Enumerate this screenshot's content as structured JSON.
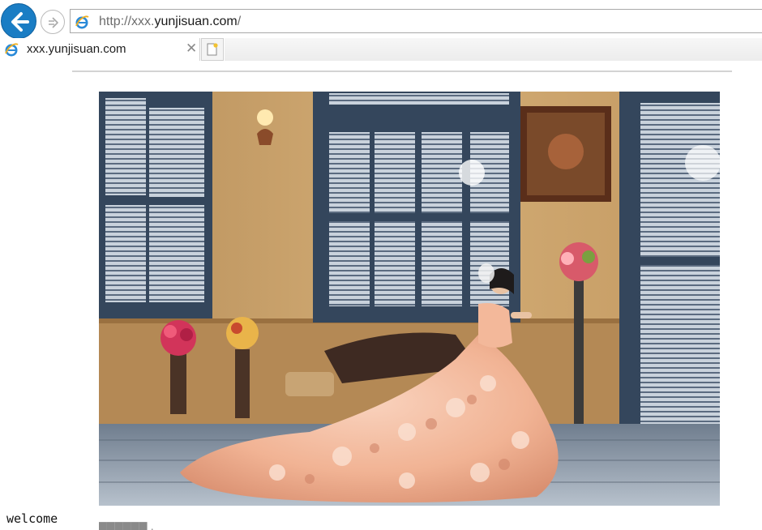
{
  "browser": {
    "address": {
      "prefix": "http://xxx.",
      "domain": "yunjisuan.com",
      "suffix": "/"
    },
    "tab": {
      "title": "xxx.yunjisuan.com",
      "close_glyph": "✕"
    },
    "icons": {
      "back": "back-arrow-icon",
      "forward": "forward-arrow-icon",
      "site": "internet-explorer-icon",
      "new_tab": "new-tab-icon"
    },
    "accent": "#1a7dc4"
  },
  "page": {
    "image": {
      "subject": "bride-in-peach-ruffled-gown",
      "colors": {
        "wall": "#c6a06a",
        "shutters": "#3d4f66",
        "dress": "#f2b79a",
        "floor": "#8e9aa8"
      }
    },
    "welcome": "welcome",
    "caption": "██████ ·"
  }
}
